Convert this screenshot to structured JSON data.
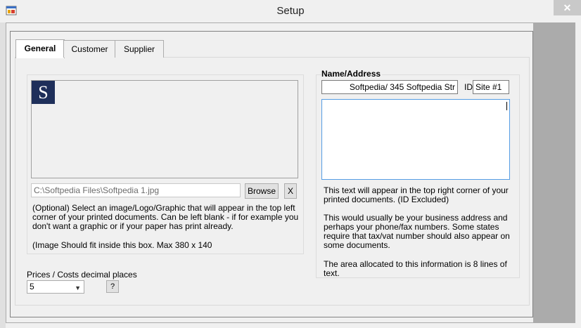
{
  "window": {
    "title": "Setup",
    "close_glyph": "✕",
    "app_icon": "app-window-icon"
  },
  "tabs": [
    {
      "label": "General",
      "active": true
    },
    {
      "label": "Customer",
      "active": false
    },
    {
      "label": "Supplier",
      "active": false
    }
  ],
  "logo": {
    "letter": "S",
    "color": "#1e2f5a"
  },
  "image_section": {
    "path_value": "C:\\Softpedia Files\\Softpedia 1.jpg",
    "browse_label": "Browse",
    "clear_label": "X",
    "help_text": "(Optional) Select an image/Logo/Graphic that will appear in the top left corner of your printed documents. Can be left blank - if for example you don't want a graphic or if your paper has print already.",
    "size_note": "(Image Should fit inside this box. Max 380 x 140"
  },
  "decimals": {
    "label": "Prices / Costs decimal places",
    "selected": "5",
    "help_button": "?"
  },
  "name_address": {
    "label": "Name/Address",
    "name_value": "Softpedia/ 345 Softpedia Str",
    "id_label": "ID",
    "id_value": "Site #1",
    "note1": "This text will appear in the top right corner of your printed documents. (ID Excluded)",
    "note2": "This would usually be your business address and perhaps your phone/fax numbers. Some states require that tax/vat number should also appear on some documents.",
    "note3": "The area allocated to this information is 8 lines of text."
  }
}
